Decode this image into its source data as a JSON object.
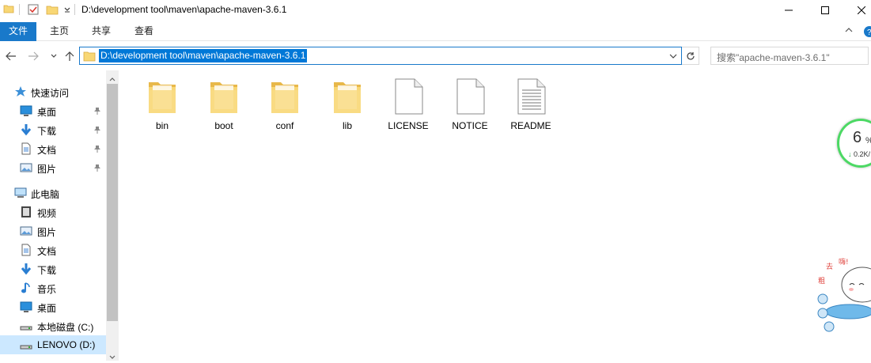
{
  "window": {
    "title": "D:\\development tool\\maven\\apache-maven-3.6.1"
  },
  "ribbon": {
    "tabs": [
      {
        "label": "文件"
      },
      {
        "label": "主页"
      },
      {
        "label": "共享"
      },
      {
        "label": "查看"
      }
    ],
    "accent": "#1979ca"
  },
  "address": {
    "path": "D:\\development tool\\maven\\apache-maven-3.6.1"
  },
  "search": {
    "placeholder": "搜索\"apache-maven-3.6.1\""
  },
  "sidebar": {
    "items": [
      {
        "label": "快速访问",
        "icon": "star-icon"
      },
      {
        "label": "桌面",
        "icon": "desktop-icon",
        "pinned": true
      },
      {
        "label": "下载",
        "icon": "download-icon",
        "pinned": true
      },
      {
        "label": "文档",
        "icon": "document-icon",
        "pinned": true
      },
      {
        "label": "图片",
        "icon": "picture-icon",
        "pinned": true
      },
      {
        "label": "此电脑",
        "icon": "computer-icon"
      },
      {
        "label": "视频",
        "icon": "video-icon"
      },
      {
        "label": "图片",
        "icon": "picture-icon"
      },
      {
        "label": "文档",
        "icon": "document-icon"
      },
      {
        "label": "下载",
        "icon": "download-icon"
      },
      {
        "label": "音乐",
        "icon": "music-icon"
      },
      {
        "label": "桌面",
        "icon": "desktop-icon"
      },
      {
        "label": "本地磁盘 (C:)",
        "icon": "drive-icon"
      },
      {
        "label": "LENOVO (D:)",
        "icon": "drive-icon",
        "selected": true
      }
    ]
  },
  "files": [
    {
      "name": "bin",
      "type": "folder"
    },
    {
      "name": "boot",
      "type": "folder"
    },
    {
      "name": "conf",
      "type": "folder"
    },
    {
      "name": "lib",
      "type": "folder"
    },
    {
      "name": "LICENSE",
      "type": "file"
    },
    {
      "name": "NOTICE",
      "type": "file"
    },
    {
      "name": "README",
      "type": "text-file"
    }
  ],
  "speed_widget": {
    "percent": "6",
    "unit": "%",
    "rate": "0.2K/"
  }
}
